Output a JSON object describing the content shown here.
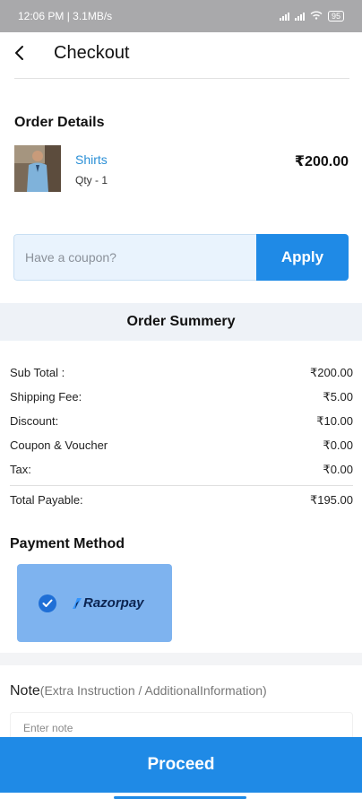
{
  "status_bar": {
    "time": "12:06 PM | 3.1MB/s",
    "alarm_icon": "alarm-clock-icon",
    "signal_icon": "signal-bars-icon",
    "wifi_icon": "wifi-icon",
    "battery": "95"
  },
  "app_bar": {
    "back_icon": "back-arrow-icon",
    "title": "Checkout"
  },
  "order_details": {
    "heading": "Order Details",
    "item": {
      "name": "Shirts",
      "qty": "Qty - 1",
      "price": "₹200.00"
    }
  },
  "coupon": {
    "placeholder": "Have a coupon?",
    "apply_label": "Apply"
  },
  "summary": {
    "heading": "Order Summery",
    "rows": [
      {
        "label": "Sub Total :",
        "value": "₹200.00"
      },
      {
        "label": "Shipping Fee:",
        "value": "₹5.00"
      },
      {
        "label": "Discount:",
        "value": "₹10.00"
      },
      {
        "label": "Coupon & Voucher",
        "value": "₹0.00"
      },
      {
        "label": "Tax:",
        "value": "₹0.00"
      }
    ],
    "total": {
      "label": "Total Payable:",
      "value": "₹195.00"
    }
  },
  "payment": {
    "heading": "Payment Method",
    "method": "Razorpay",
    "selected_icon": "checkmark-circle-icon"
  },
  "note": {
    "label": "Note",
    "hint": "(Extra Instruction / AdditionalInformation)",
    "placeholder": "Enter note"
  },
  "proceed_label": "Proceed",
  "colors": {
    "accent": "#1f8ae6",
    "payment_card": "#7eb3ef",
    "status_bar": "#a9a9ab"
  }
}
